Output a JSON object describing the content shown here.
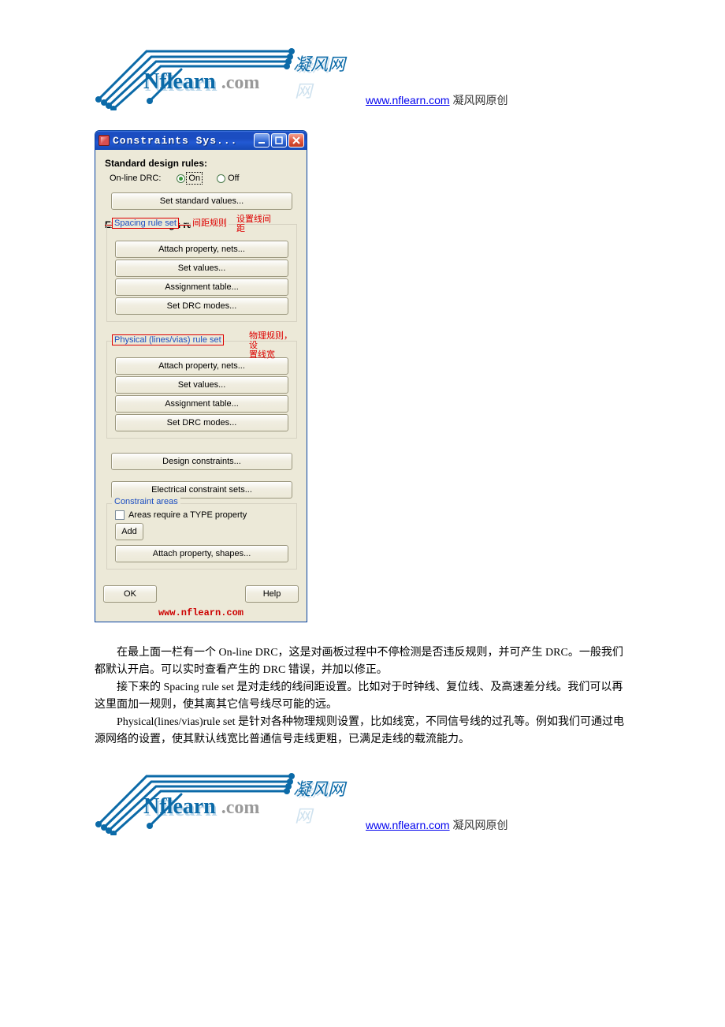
{
  "header": {
    "logo_main": "Nflearn",
    "logo_sub": ".com",
    "logo_cn": "凝风网",
    "site_url": "www.nflearn.com",
    "site_tag_suffix": "  凝风网原创"
  },
  "window": {
    "title": "Constraints Sys...",
    "std_rules_label": "Standard design rules:",
    "online_drc_label": "On-line DRC:",
    "radio_on": "On",
    "radio_off": "Off",
    "set_standard_values": "Set standard values...",
    "ext_rules_label": "Extended design rules:",
    "spacing_legend": "Spacing rule set",
    "spacing_anno1": "间距规则",
    "spacing_anno2": "设置线间距",
    "btn_attach_nets": "Attach property, nets...",
    "btn_set_values": "Set values...",
    "btn_assignment_table": "Assignment table...",
    "btn_set_drc_modes": "Set DRC modes...",
    "physical_legend": "Physical (lines/vias) rule set",
    "physical_anno": "物理规则，设置线宽",
    "design_constraints": "Design constraints...",
    "electrical_sets": "Electrical constraint sets...",
    "constraint_areas_legend": "Constraint areas",
    "areas_require_type": "Areas require a TYPE property",
    "btn_add": "Add",
    "btn_attach_shapes": "Attach property, shapes...",
    "btn_ok": "OK",
    "btn_help": "Help",
    "watermark": "www.nflearn.com"
  },
  "essay": {
    "p1": "在最上面一栏有一个 On-line DRC，这是对画板过程中不停检测是否违反规则，并可产生 DRC。一般我们都默认开启。可以实时查看产生的  DRC  错误，并加以修正。",
    "p2": "接下来的  Spacing rule set  是对走线的线间距设置。比如对于时钟线、复位线、及高速差分线。我们可以再这里面加一规则，使其离其它信号线尽可能的远。",
    "p3": "Physical(lines/vias)rule set  是针对各种物理规则设置，比如线宽，不同信号线的过孔等。例如我们可通过电源网络的设置，使其默认线宽比普通信号走线更粗，已满足走线的载流能力。"
  }
}
